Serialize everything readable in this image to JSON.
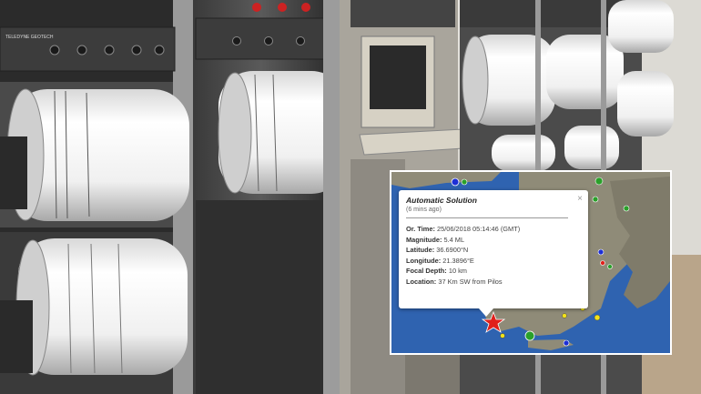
{
  "popup": {
    "title": "Automatic Solution",
    "subtitle": "(6 mins ago)",
    "close_glyph": "×",
    "rows": [
      {
        "label": "Or. Time:",
        "value": "25/06/2018  05:14:46 (GMT)"
      },
      {
        "label": "Magnitude:",
        "value": "5.4 ML"
      },
      {
        "label": "Latitude:",
        "value": "36.6900°N"
      },
      {
        "label": "Longitude:",
        "value": "21.3896°E"
      },
      {
        "label": "Focal Depth:",
        "value": "10 km"
      },
      {
        "label": "Location:",
        "value": "37 Km SW from Pilos"
      }
    ]
  },
  "equipment_labels": {
    "brand": "TELEDYNE GEOTECH"
  },
  "colors": {
    "sea": "#2f63b0",
    "land": "#8f8b78",
    "epicenter_star": "#e0201c",
    "event_green": "#2aa02a",
    "event_yellow": "#f2e21b",
    "event_blue": "#1d2fd6"
  },
  "icons": {
    "epicenter": "star-icon",
    "close": "close-icon"
  }
}
